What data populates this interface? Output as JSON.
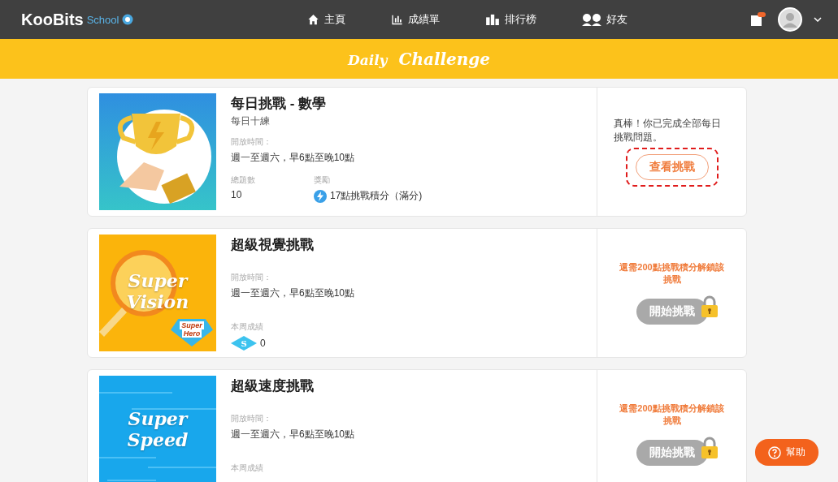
{
  "header": {
    "logo": {
      "brand": "KooBits",
      "sub": "School"
    },
    "nav": [
      {
        "label": "主頁"
      },
      {
        "label": "成績單"
      },
      {
        "label": "排行榜"
      },
      {
        "label": "好友"
      }
    ]
  },
  "banner": {
    "word_1": "Daily",
    "word_2": "Challenge"
  },
  "cards": [
    {
      "cover": {
        "kind": "trophy"
      },
      "title": "每日挑戰 - 數學",
      "subtitle": "每日十練",
      "open_label": "開放時間：",
      "open_time": "週一至週六，早6點至晚10點",
      "stats": [
        {
          "kind": "count",
          "label": "總題數",
          "value": "10"
        },
        {
          "kind": "reward",
          "label": "獎勵",
          "value": "17點挑戰積分（滿分)"
        }
      ],
      "action": {
        "kind": "done",
        "message": "真棒！你已完成全部每日挑戰問題。",
        "button": "查看挑戰",
        "highlighted": true
      }
    },
    {
      "cover": {
        "kind": "vision",
        "line_1": "Super",
        "line_2": "Vision",
        "badge_1": "Super",
        "badge_2": "Hero"
      },
      "title": "超級視覺挑戰",
      "open_label": "開放時間：",
      "open_time": "週一至週六，早6點至晚10點",
      "stats": [
        {
          "kind": "score",
          "label": "本周成績",
          "badge": "S",
          "value": "0"
        }
      ],
      "action": {
        "kind": "locked",
        "message": "還需200點挑戰積分解鎖該挑戰",
        "button": "開始挑戰"
      }
    },
    {
      "cover": {
        "kind": "speed",
        "line_1": "Super",
        "line_2": "Speed"
      },
      "title": "超級速度挑戰",
      "open_label": "開放時間：",
      "open_time": "週一至週六，早6點至晚10點",
      "stats": [
        {
          "kind": "label_only",
          "label": "本周成績"
        }
      ],
      "action": {
        "kind": "locked",
        "message": "還需200點挑戰積分解鎖該挑戰",
        "button": "開始挑戰"
      }
    }
  ],
  "help": {
    "label": "幫助"
  }
}
